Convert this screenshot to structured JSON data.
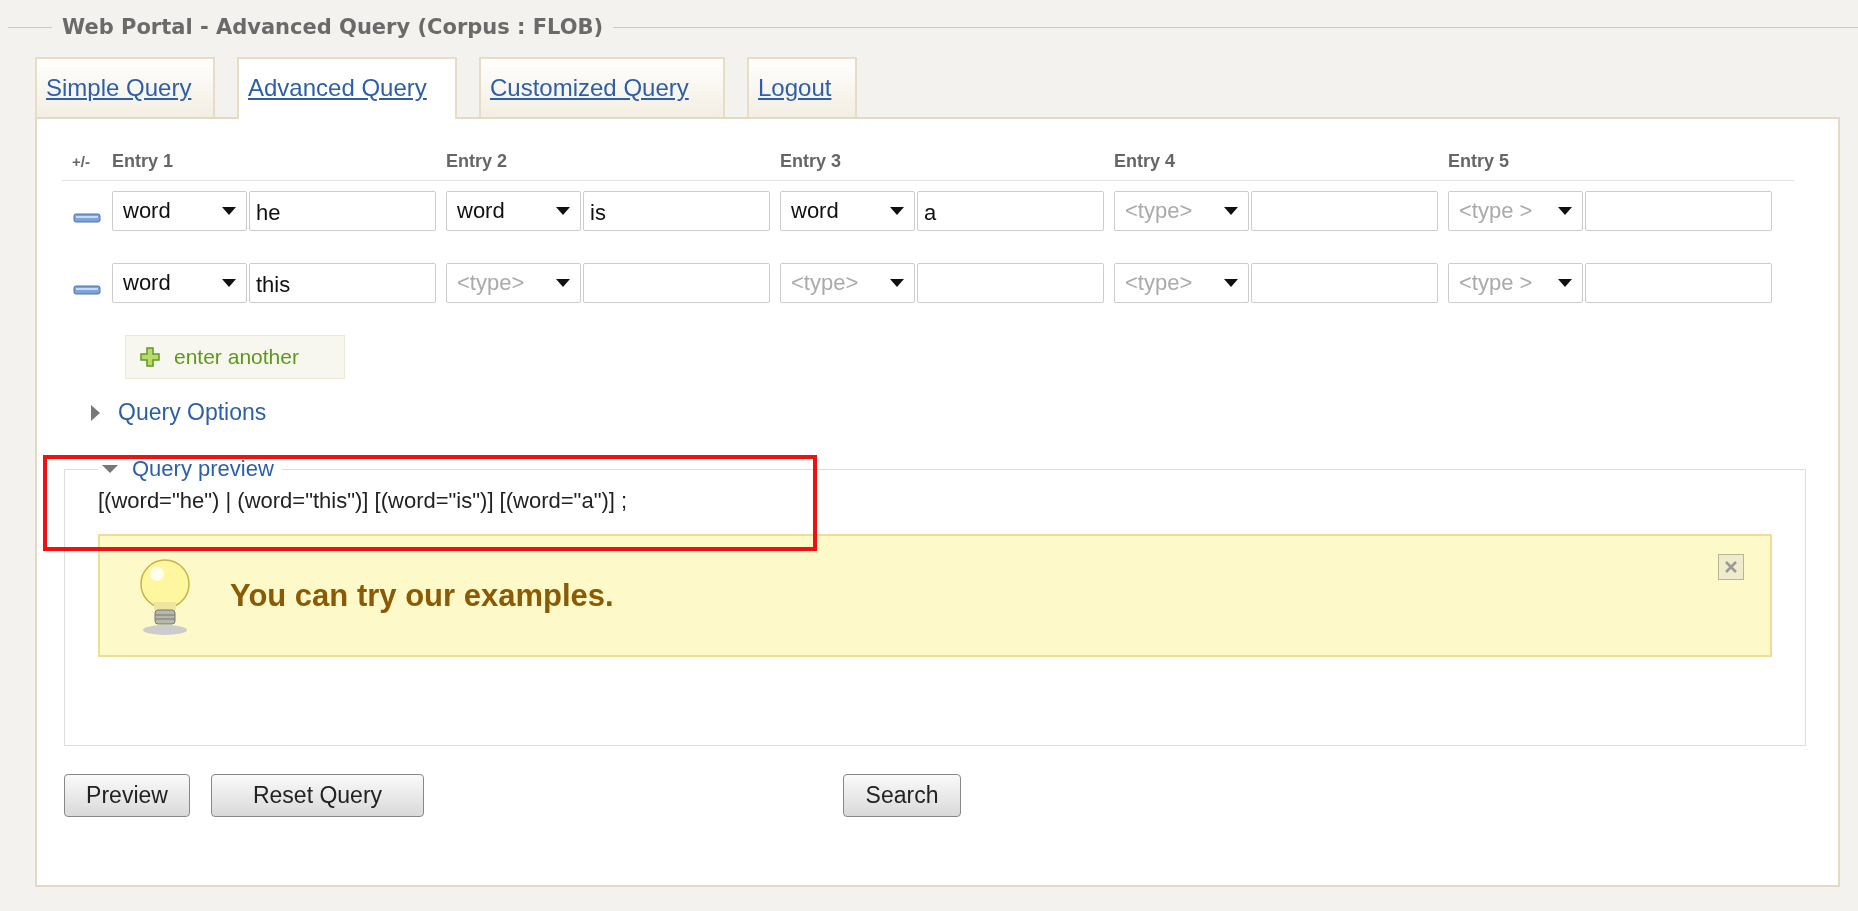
{
  "title": "Web Portal - Advanced Query (Corpus : FLOB)",
  "tabs": [
    {
      "label": "Simple Query",
      "selected": false
    },
    {
      "label": "Advanced Query",
      "selected": true
    },
    {
      "label": "Customized Query",
      "selected": false
    },
    {
      "label": "Logout",
      "selected": false
    }
  ],
  "entries": {
    "toggle_header": "+/-",
    "columns": [
      "Entry 1",
      "Entry 2",
      "Entry 3",
      "Entry 4",
      "Entry 5"
    ],
    "rows": [
      {
        "cells": [
          {
            "type": "word",
            "type_is_placeholder": false,
            "value": "he"
          },
          {
            "type": "word",
            "type_is_placeholder": false,
            "value": "is"
          },
          {
            "type": "word",
            "type_is_placeholder": false,
            "value": "a"
          },
          {
            "type": "<type>",
            "type_is_placeholder": true
          },
          {
            "type": "<type >",
            "type_is_placeholder": true
          }
        ]
      },
      {
        "cells": [
          {
            "type": "word",
            "type_is_placeholder": false,
            "value": "this"
          },
          {
            "type": "<type>",
            "type_is_placeholder": true
          },
          {
            "type": "<type>",
            "type_is_placeholder": true
          },
          {
            "type": "<type>",
            "type_is_placeholder": true
          },
          {
            "type": "<type >",
            "type_is_placeholder": true
          }
        ]
      }
    ]
  },
  "add_button": "enter another",
  "query_options": {
    "label": "Query Options",
    "expanded": false
  },
  "query_preview": {
    "label": "Query preview",
    "expanded": true,
    "highlighted": true,
    "text": "[(word=\"he\") | (word=\"this\")] [(word=\"is\")] [(word=\"a\")] ;"
  },
  "tip": {
    "text": "You can try our examples."
  },
  "buttons": [
    "Preview",
    "Reset Query"
  ],
  "search_button": "Search"
}
